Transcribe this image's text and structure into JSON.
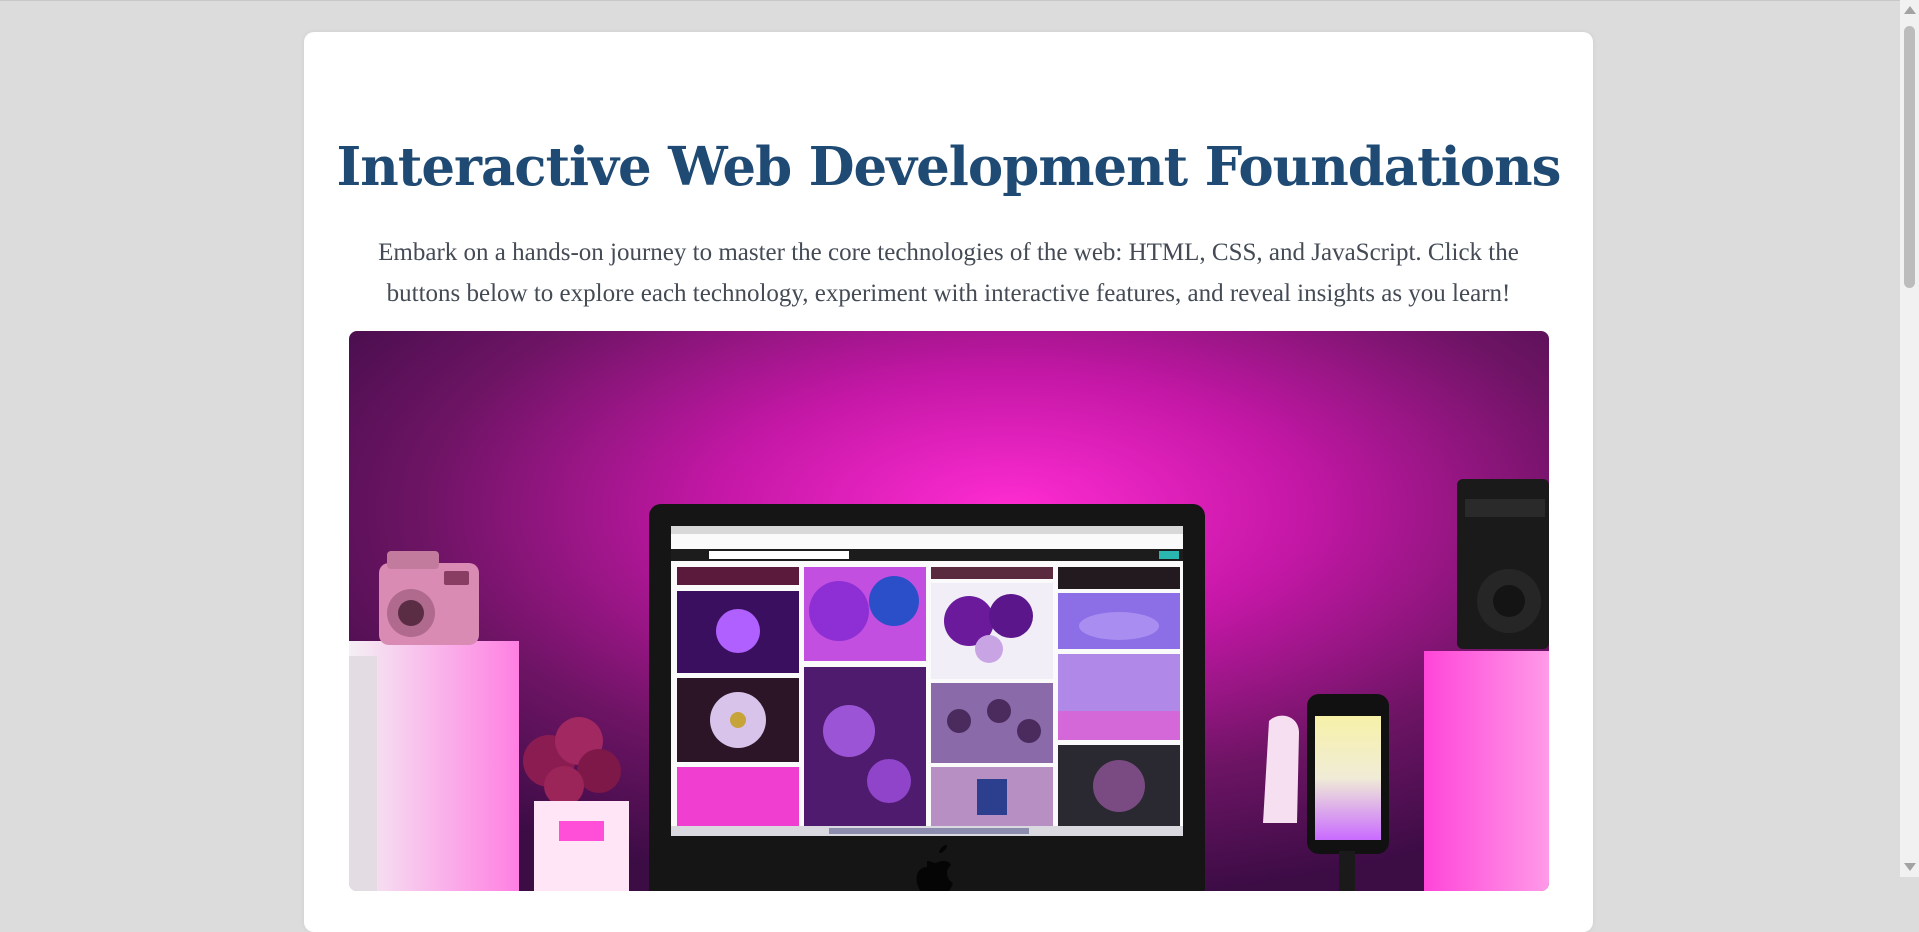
{
  "page": {
    "title": "Interactive Web Development Foundations",
    "intro": "Embark on a hands-on journey to master the core technologies of the web: HTML, CSS, and JavaScript. Click the buttons below to explore each technology, experiment with interactive features, and reveal insights as you learn!"
  },
  "hero": {
    "description": "Desk setup with a computer monitor showing a purple photo gallery, pink neon backlight, instant camera, flowers, phone with color picker and speaker",
    "monitor_brand_icon": "apple-logo-icon",
    "colors": {
      "glow": "#ff2cc8",
      "background_dark": "#3a0f4a",
      "title_text": "#1f4a73"
    }
  },
  "scrollbar": {
    "up_icon": "scroll-up-arrow-icon",
    "down_icon": "scroll-down-arrow-icon"
  }
}
